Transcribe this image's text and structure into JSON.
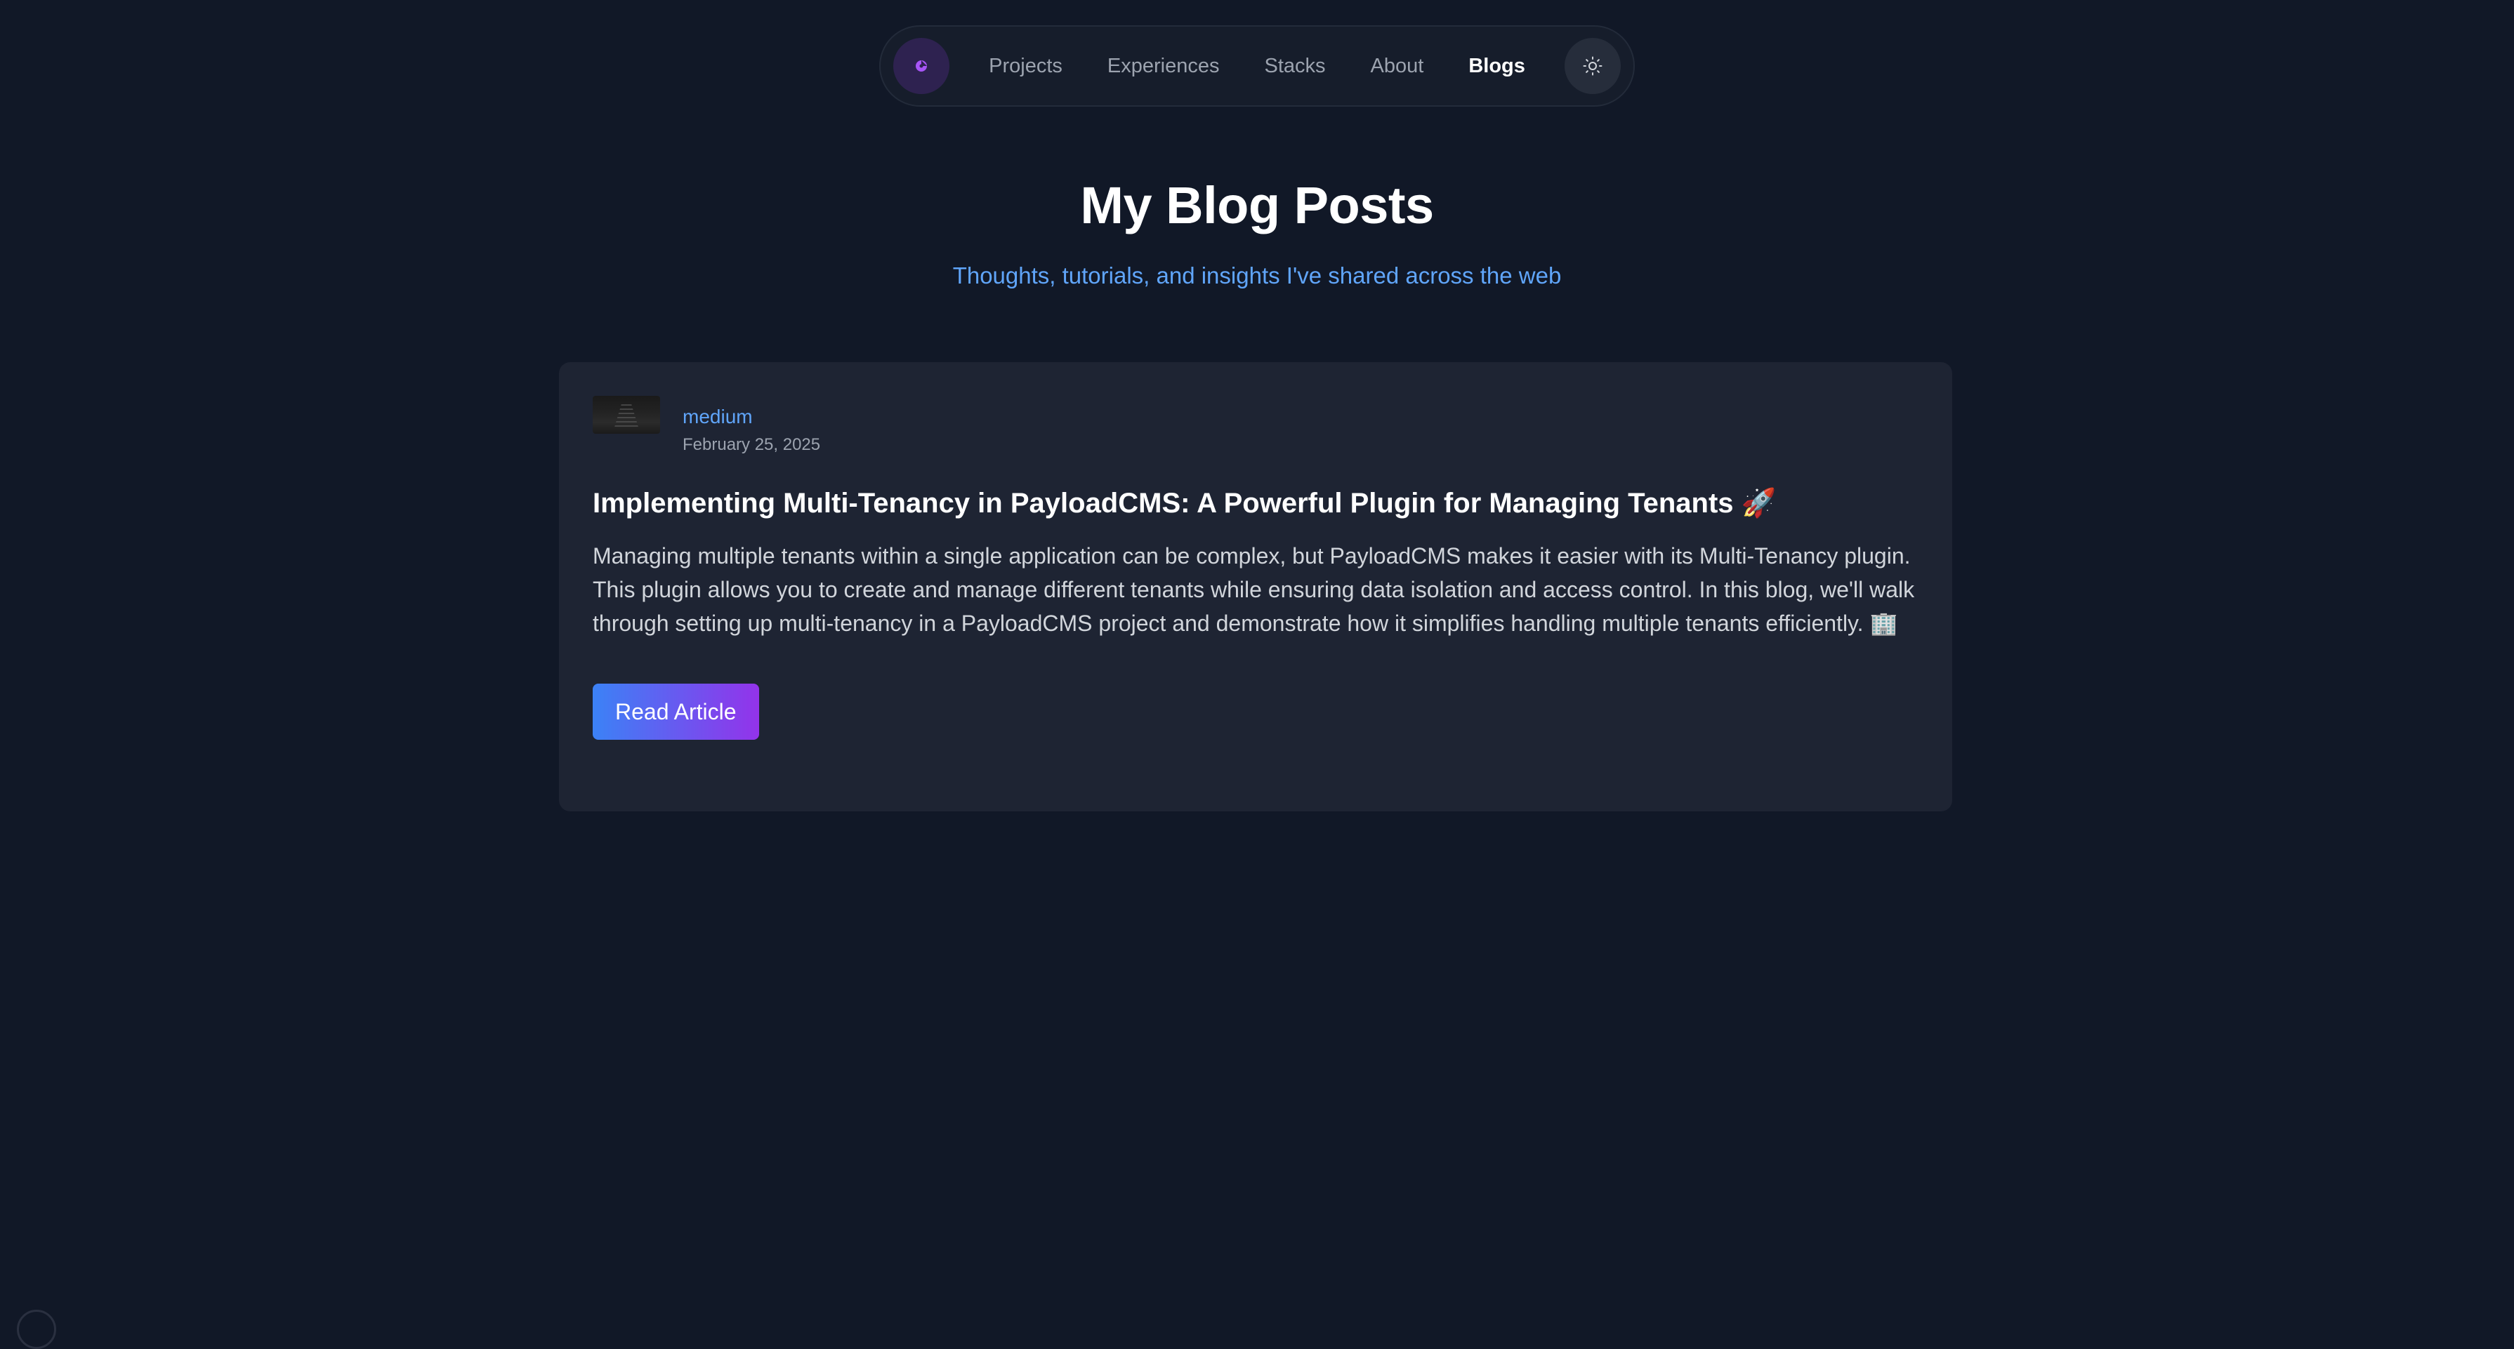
{
  "nav": {
    "items": [
      {
        "label": "Projects",
        "active": false
      },
      {
        "label": "Experiences",
        "active": false
      },
      {
        "label": "Stacks",
        "active": false
      },
      {
        "label": "About",
        "active": false
      },
      {
        "label": "Blogs",
        "active": true
      }
    ],
    "logo_icon": "logo-icon",
    "theme_icon": "sun-icon"
  },
  "header": {
    "title": "My Blog Posts",
    "subtitle": "Thoughts, tutorials, and insights I've shared across the web"
  },
  "posts": [
    {
      "source": "medium",
      "date": "February 25, 2025",
      "title": "Implementing Multi-Tenancy in PayloadCMS: A Powerful Plugin for Managing Tenants 🚀",
      "excerpt": "Managing multiple tenants within a single application can be complex, but PayloadCMS makes it easier with its Multi-Tenancy plugin. This plugin allows you to create and manage different tenants while ensuring data isolation and access control. In this blog, we'll walk through setting up multi-tenancy in a PayloadCMS project and demonstrate how it simplifies handling multiple tenants efficiently. 🏢",
      "button_label": "Read Article"
    }
  ],
  "colors": {
    "background": "#111827",
    "card": "#1e2433",
    "accent_blue": "#60a5fa",
    "accent_purple": "#9333ea"
  }
}
